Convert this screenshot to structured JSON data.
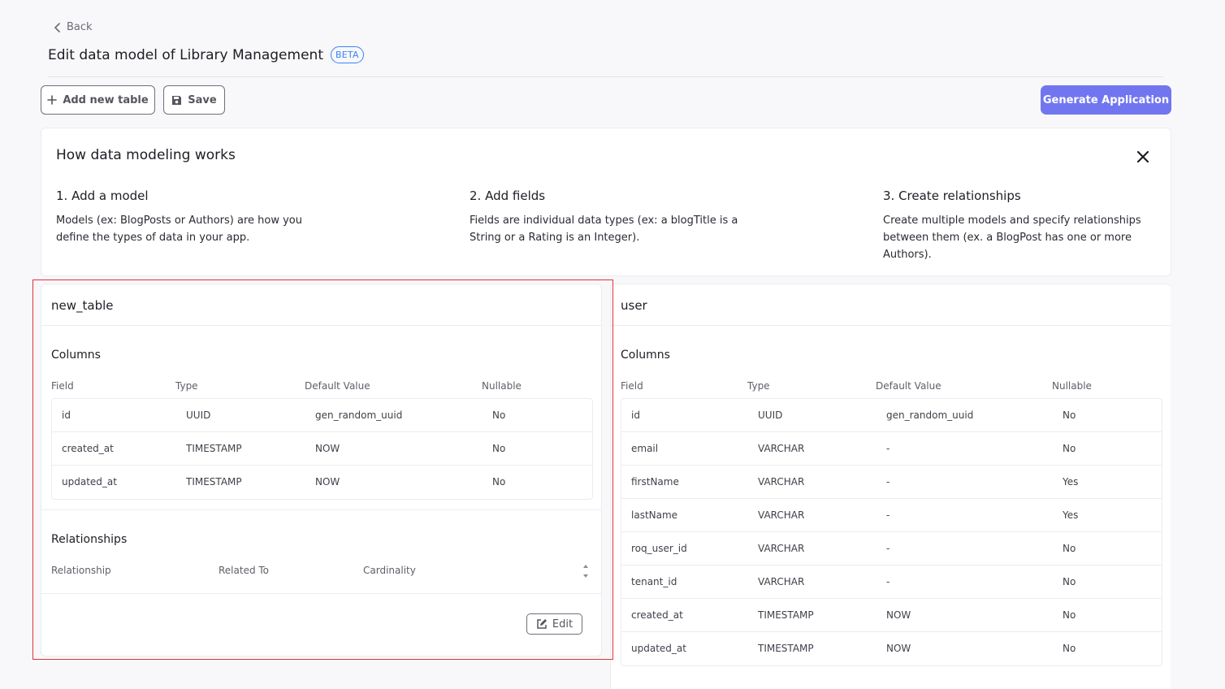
{
  "nav": {
    "back_label": "Back"
  },
  "page": {
    "title": "Edit data model of Library Management",
    "badge": "BETA"
  },
  "toolbar": {
    "add_table_label": "Add new table",
    "save_label": "Save",
    "generate_label": "Generate Application"
  },
  "info": {
    "title": "How data modeling works",
    "steps": [
      {
        "title": "1. Add a model",
        "lines": [
          "Models (ex: BlogPosts or Authors) are how you",
          "define the types of data in your app."
        ]
      },
      {
        "title": "2. Add fields",
        "lines": [
          "Fields are individual data types (ex: a blogTitle is a",
          "String or a Rating is an Integer)."
        ]
      },
      {
        "title": "3. Create relationships",
        "lines": [
          "Create multiple models and specify relationships",
          "between them (ex. a BlogPost has one or more",
          "Authors)."
        ]
      }
    ]
  },
  "tables": [
    {
      "name": "new_table",
      "columns_label": "Columns",
      "headers": [
        "Field",
        "Type",
        "Default Value",
        "Nullable"
      ],
      "rows": [
        [
          "id",
          "UUID",
          "gen_random_uuid",
          "No"
        ],
        [
          "created_at",
          "TIMESTAMP",
          "NOW",
          "No"
        ],
        [
          "updated_at",
          "TIMESTAMP",
          "NOW",
          "No"
        ]
      ],
      "relationships_label": "Relationships",
      "relationship_headers": [
        "Relationship",
        "Related To",
        "Cardinality"
      ],
      "edit_label": "Edit"
    },
    {
      "name": "user",
      "columns_label": "Columns",
      "headers": [
        "Field",
        "Type",
        "Default Value",
        "Nullable"
      ],
      "rows": [
        [
          "id",
          "UUID",
          "gen_random_uuid",
          "No"
        ],
        [
          "email",
          "VARCHAR",
          "-",
          "No"
        ],
        [
          "firstName",
          "VARCHAR",
          "-",
          "Yes"
        ],
        [
          "lastName",
          "VARCHAR",
          "-",
          "Yes"
        ],
        [
          "roq_user_id",
          "VARCHAR",
          "-",
          "No"
        ],
        [
          "tenant_id",
          "VARCHAR",
          "-",
          "No"
        ],
        [
          "created_at",
          "TIMESTAMP",
          "NOW",
          "No"
        ],
        [
          "updated_at",
          "TIMESTAMP",
          "NOW",
          "No"
        ]
      ]
    }
  ],
  "colors": {
    "accent": "#7176f0",
    "beta": "#3b82f6",
    "highlight": "#e0323a"
  }
}
